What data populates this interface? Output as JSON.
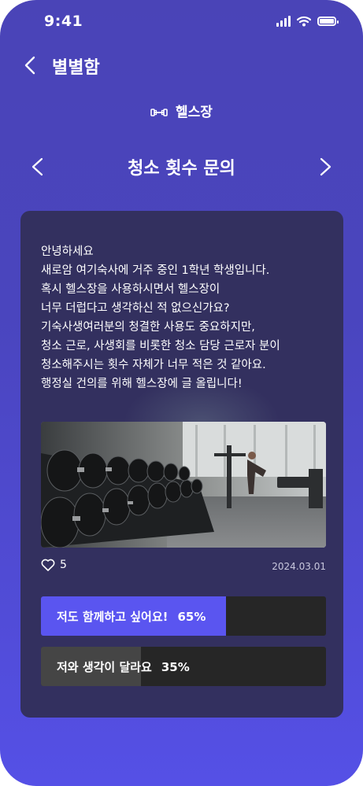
{
  "status_bar": {
    "time": "9:41"
  },
  "header": {
    "title": "별별함"
  },
  "category": {
    "label": "헬스장"
  },
  "post": {
    "title": "청소 횟수 문의",
    "body_lines": [
      "안녕하세요",
      "새로암 여기숙사에 거주 중인 1학년 학생입니다.",
      "혹시 헬스장을 사용하시면서 헬스장이",
      "너무 더럽다고 생각하신 적 없으신가요?",
      "기숙사생여러분의 청결한 사용도 중요하지만,",
      "청소 근로, 사생회를 비롯한 청소 담당 근로자 분이",
      "청소해주시는 횟수 자체가 너무 적은 것 같아요.",
      "행정실 건의를 위해 헬스장에 글 올립니다!"
    ],
    "likes": "5",
    "date": "2024.03.01"
  },
  "votes": [
    {
      "label": "저도 함께하고 싶어요!",
      "percent_text": "65%",
      "percent": 65,
      "color": "#5a55f0"
    },
    {
      "label": "저와 생각이 달라요",
      "percent_text": "35%",
      "percent": 35,
      "color": "#454545"
    }
  ],
  "icons": {
    "back": "chevron-left-icon",
    "prev": "chevron-left-icon",
    "next": "chevron-right-icon",
    "category": "dumbbell-icon",
    "like": "heart-outline-icon"
  }
}
